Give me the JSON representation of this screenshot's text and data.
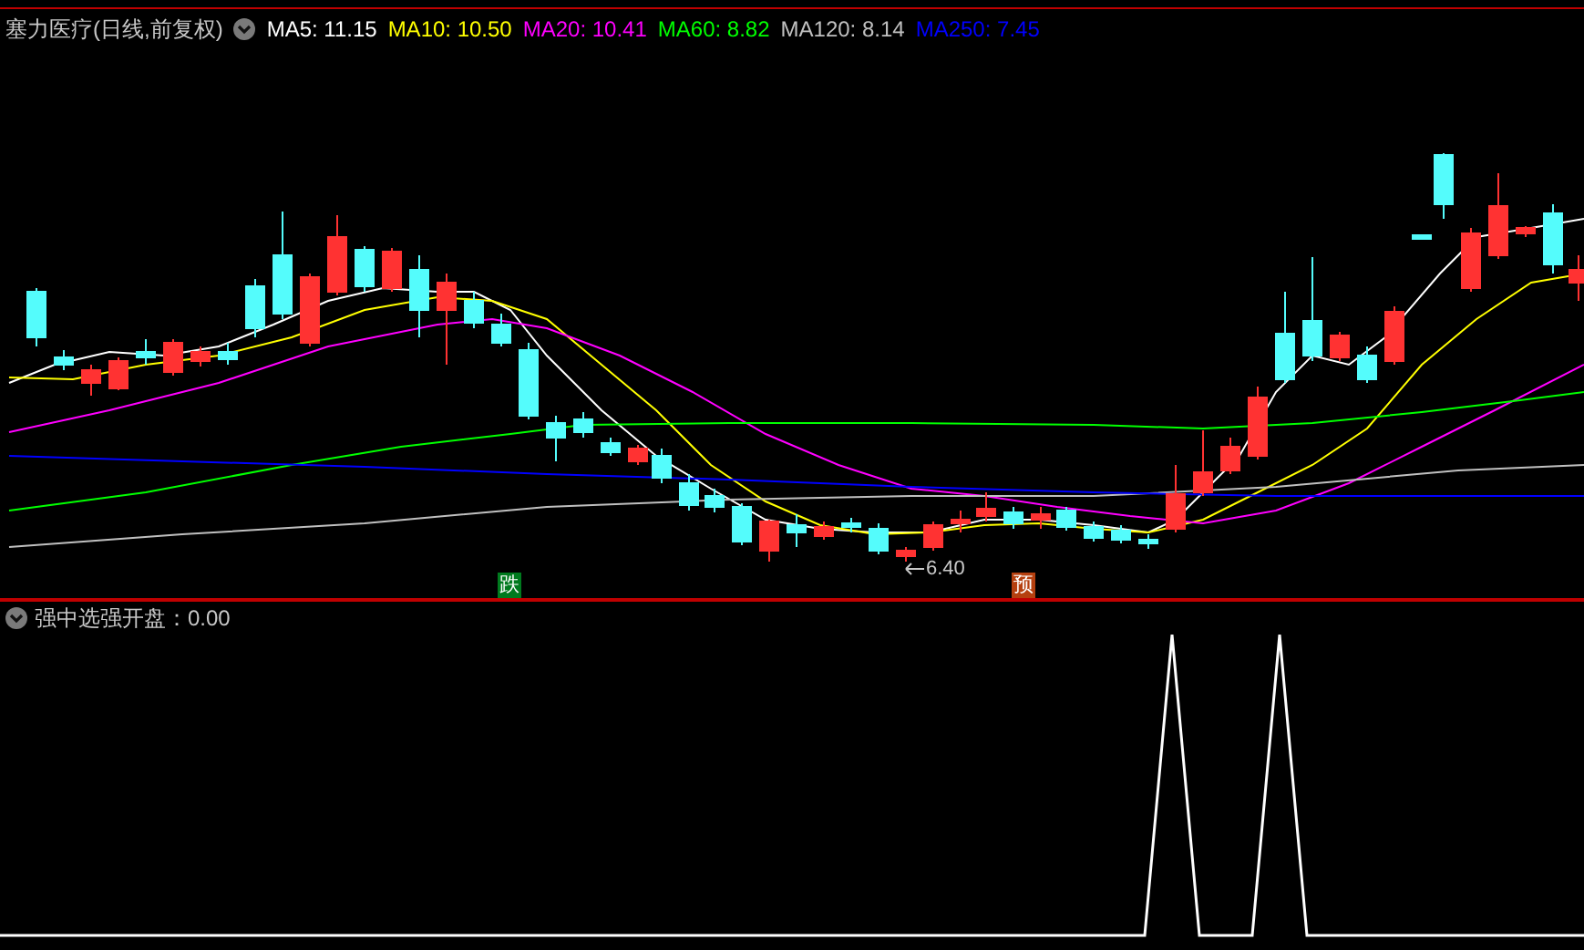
{
  "chart_title": "塞力医疗(日线,前复权)",
  "moving_averages": [
    {
      "text": "MA5: 11.15",
      "color": "#ffffff"
    },
    {
      "text": "MA10: 10.50",
      "color": "#ffff00"
    },
    {
      "text": "MA20: 10.41",
      "color": "#ff00ff"
    },
    {
      "text": "MA60: 8.82",
      "color": "#00ff00"
    },
    {
      "text": "MA120: 8.14",
      "color": "#c0c0c0"
    },
    {
      "text": "MA250: 7.45",
      "color": "#0000ff"
    }
  ],
  "markers": [
    {
      "kind": "tag",
      "text": "跌",
      "color": "#007a1e"
    },
    {
      "kind": "price",
      "text": "6.40"
    },
    {
      "kind": "tag",
      "text": "预",
      "color": "#b5400f"
    }
  ],
  "indicator": {
    "label": "强中选强开盘：0.00"
  }
}
